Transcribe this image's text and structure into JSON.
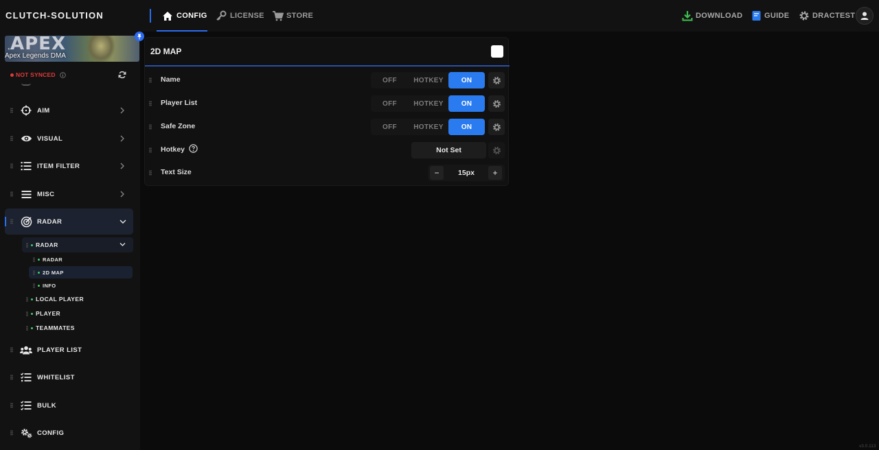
{
  "app": {
    "brand": "CLUTCH-SOLUTION",
    "version": "v3.0.113"
  },
  "topnav": {
    "tabs": [
      {
        "label": "CONFIG",
        "icon": "home-icon",
        "active": true
      },
      {
        "label": "LICENSE",
        "icon": "key-icon",
        "active": false
      },
      {
        "label": "STORE",
        "icon": "cart-icon",
        "active": false
      }
    ],
    "right": [
      {
        "label": "DOWNLOAD",
        "icon": "download-icon"
      },
      {
        "label": "GUIDE",
        "icon": "book-icon"
      },
      {
        "label": "DRACTEST",
        "icon": "gear-icon"
      }
    ]
  },
  "sidebar": {
    "banner": {
      "logo_text": "APEX",
      "game_name": "Apex Legends DMA"
    },
    "sync_status": "NOT SYNCED",
    "items": [
      {
        "label": "AIM",
        "icon": "crosshair-icon"
      },
      {
        "label": "VISUAL",
        "icon": "eye-icon"
      },
      {
        "label": "ITEM FILTER",
        "icon": "list-icon"
      },
      {
        "label": "MISC",
        "icon": "menu-icon"
      },
      {
        "label": "RADAR",
        "icon": "radar-icon",
        "active": true
      },
      {
        "label": "PLAYER LIST",
        "icon": "users-icon"
      },
      {
        "label": "WHITELIST",
        "icon": "checklist-icon"
      },
      {
        "label": "BULK",
        "icon": "checklist-icon"
      },
      {
        "label": "CONFIG",
        "icon": "gears-icon"
      }
    ],
    "radar_children": {
      "group": "RADAR",
      "group_children": [
        "RADAR",
        "2D MAP",
        "INFO"
      ],
      "others": [
        "LOCAL PLAYER",
        "PLAYER",
        "TEAMMATES"
      ]
    }
  },
  "panel": {
    "title": "2D MAP",
    "enabled": true,
    "rows": [
      {
        "label": "Name",
        "options": [
          "OFF",
          "HOTKEY",
          "ON"
        ],
        "selected": "ON"
      },
      {
        "label": "Player List",
        "options": [
          "OFF",
          "HOTKEY",
          "ON"
        ],
        "selected": "ON"
      },
      {
        "label": "Safe Zone",
        "options": [
          "OFF",
          "HOTKEY",
          "ON"
        ],
        "selected": "ON"
      }
    ],
    "hotkey": {
      "label": "Hotkey",
      "value": "Not Set"
    },
    "text_size": {
      "label": "Text Size",
      "value": "15px",
      "minus": "−",
      "plus": "+"
    }
  },
  "colors": {
    "accent": "#2b7bf0",
    "danger": "#e03a3a",
    "sub_dot": "#3ecf6a"
  }
}
